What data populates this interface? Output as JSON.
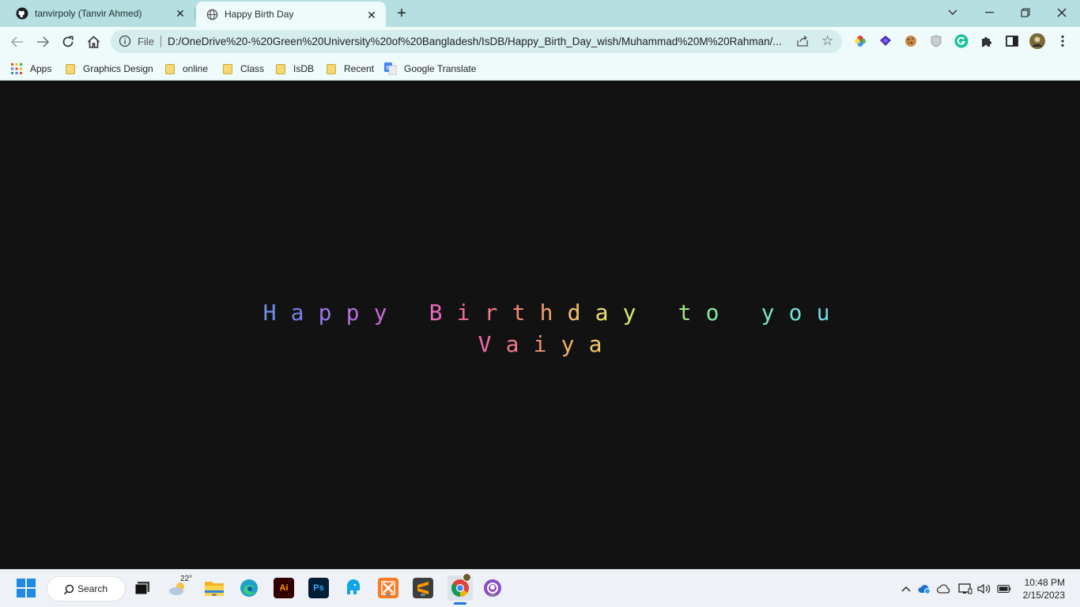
{
  "browser": {
    "tabs": [
      {
        "title": "tanvirpoly (Tanvir Ahmed)",
        "icon": "github-icon",
        "active": false
      },
      {
        "title": "Happy Birth Day",
        "icon": "globe-icon",
        "active": true
      }
    ],
    "omnibox": {
      "scheme_label": "File",
      "url": "D:/OneDrive%20-%20Green%20University%20of%20Bangladesh/IsDB/Happy_Birth_Day_wish/Muhammad%20M%20Rahman/..."
    },
    "bookmarks": [
      {
        "label": "Apps",
        "icon": "apps-grid-icon"
      },
      {
        "label": "Graphics Design",
        "icon": "folder-icon"
      },
      {
        "label": "online",
        "icon": "folder-icon"
      },
      {
        "label": "Class",
        "icon": "folder-icon"
      },
      {
        "label": "IsDB",
        "icon": "folder-icon"
      },
      {
        "label": "Recent",
        "icon": "folder-icon"
      },
      {
        "label": "Google Translate",
        "icon": "google-translate-icon"
      }
    ]
  },
  "page": {
    "background": "#121212",
    "line1": [
      "H",
      "a",
      "p",
      "p",
      "y",
      " ",
      "B",
      "i",
      "r",
      "t",
      "h",
      "d",
      "a",
      "y",
      " ",
      "t",
      "o",
      " ",
      "y",
      "o",
      "u"
    ],
    "line2": [
      "V",
      "a",
      "i",
      "y",
      "a"
    ],
    "line1_colors": [
      "#6f8fe8",
      "#7a7fe6",
      "#9a76e6",
      "#b46fe0",
      "#c86ad8",
      "",
      "#e86ab8",
      "#ee6a9e",
      "#f07a84",
      "#f08a70",
      "#f3a06a",
      "#f2c46e",
      "#eede72",
      "#d8e76e",
      "",
      "#9de87a",
      "#82e8a2",
      "",
      "#74e6c8",
      "#70e2dc",
      "#72d8ea"
    ],
    "line2_colors": [
      "#ea6aa8",
      "#f07a88",
      "#f08e72",
      "#f2ae6a",
      "#f0c86e"
    ]
  },
  "taskbar": {
    "search_label": "Search",
    "weather_temp": "22°",
    "time": "10:48 PM",
    "date": "2/15/2023"
  }
}
